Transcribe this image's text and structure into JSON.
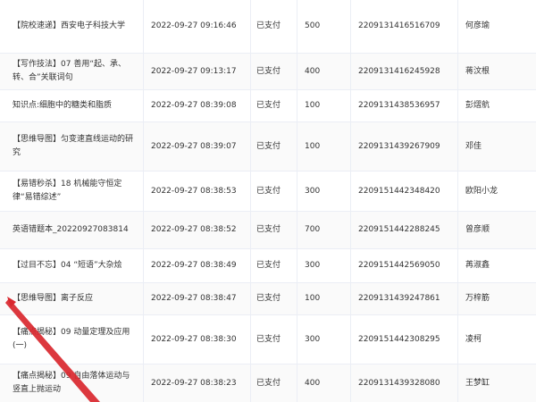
{
  "rows": [
    {
      "title": "【院校速递】西安电子科技大学",
      "time": "2022-09-27 09:16:46",
      "status": "已支付",
      "amount": "500",
      "order": "2209131416516709",
      "user": "何彦瑜"
    },
    {
      "title": "【写作技法】07 善用“起、承、转、合”关联词句",
      "time": "2022-09-27 09:13:17",
      "status": "已支付",
      "amount": "400",
      "order": "2209131416245928",
      "user": "蒋汶根"
    },
    {
      "title": "知识点:细胞中的糖类和脂质",
      "time": "2022-09-27 08:39:08",
      "status": "已支付",
      "amount": "100",
      "order": "2209131438536957",
      "user": "彭熠航"
    },
    {
      "title": "【思维导图】匀变速直线运动的研究",
      "time": "2022-09-27 08:39:07",
      "status": "已支付",
      "amount": "100",
      "order": "2209131439267909",
      "user": "邓佳"
    },
    {
      "title": "【易错秒杀】18 机械能守恒定律“易错综述”",
      "time": "2022-09-27 08:38:53",
      "status": "已支付",
      "amount": "300",
      "order": "2209151442348420",
      "user": "欧阳小龙"
    },
    {
      "title": "英语错题本_20220927083814",
      "time": "2022-09-27 08:38:52",
      "status": "已支付",
      "amount": "700",
      "order": "2209151442288245",
      "user": "曾彦顺"
    },
    {
      "title": "【过目不忘】04 “短语”大杂烩",
      "time": "2022-09-27 08:38:49",
      "status": "已支付",
      "amount": "300",
      "order": "2209151442569050",
      "user": "苒淑鑫"
    },
    {
      "title": "【思维导图】离子反应",
      "time": "2022-09-27 08:38:47",
      "status": "已支付",
      "amount": "100",
      "order": "2209131439247861",
      "user": "万梓筋"
    },
    {
      "title": "【痛点揭秘】09 动量定理及应用(一)",
      "time": "2022-09-27 08:38:30",
      "status": "已支付",
      "amount": "300",
      "order": "2209151442308295",
      "user": "凌柯"
    },
    {
      "title": "【痛点揭秘】09 自由落体运动与竖直上抛运动",
      "time": "2022-09-27 08:38:23",
      "status": "已支付",
      "amount": "400",
      "order": "2209131439328080",
      "user": "王梦缸"
    }
  ],
  "annotation_color": "#d9272e",
  "row_border_color": "#ebeef5"
}
